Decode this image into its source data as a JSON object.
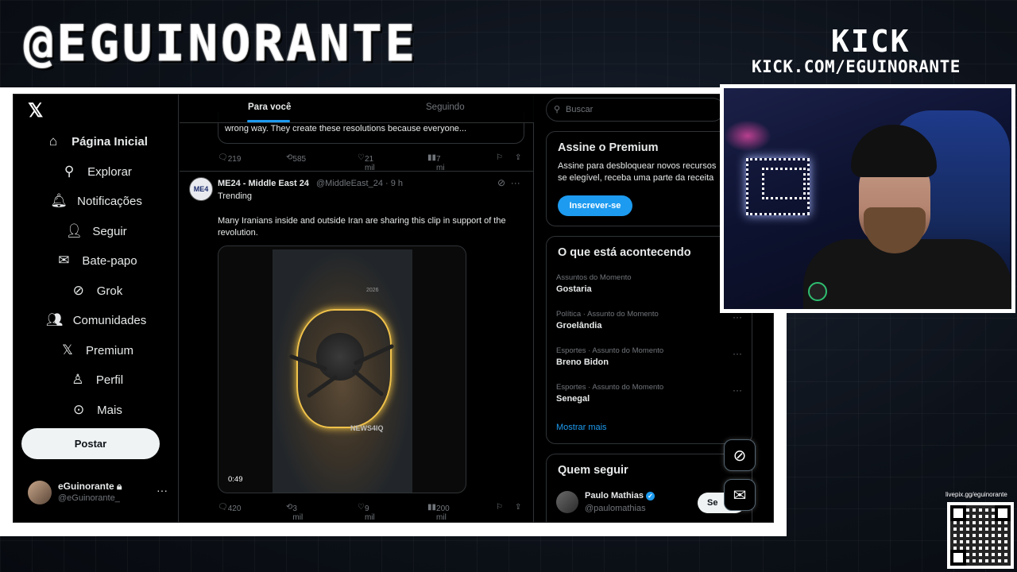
{
  "overlay": {
    "handle": "@EGUINORANTE",
    "platform": "KICK",
    "channel_url": "KICK.COM/EGUINORANTE",
    "qr_label": "livepix.gg/eguinorante"
  },
  "sidebar": {
    "items": [
      {
        "label": "Página Inicial",
        "icon": "home-icon"
      },
      {
        "label": "Explorar",
        "icon": "search-icon"
      },
      {
        "label": "Notificações",
        "icon": "bell-icon"
      },
      {
        "label": "Seguir",
        "icon": "follow-icon"
      },
      {
        "label": "Bate-papo",
        "icon": "mail-icon"
      },
      {
        "label": "Grok",
        "icon": "grok-icon"
      },
      {
        "label": "Comunidades",
        "icon": "communities-icon"
      },
      {
        "label": "Premium",
        "icon": "x-icon"
      },
      {
        "label": "Perfil",
        "icon": "profile-icon"
      },
      {
        "label": "Mais",
        "icon": "more-icon"
      }
    ],
    "post_button": "Postar",
    "profile": {
      "name": "eGuinorante",
      "handle": "@eGuinorante_"
    }
  },
  "timeline": {
    "tabs": {
      "for_you": "Para você",
      "following": "Seguindo"
    },
    "prev_post": {
      "quote_text": "wrong way. They create these resolutions because everyone...",
      "replies": "219",
      "reposts": "585",
      "likes": "21 mil",
      "views": "7 mi"
    },
    "post": {
      "avatar_text": "ME4",
      "author": "ME24 - Middle East 24",
      "meta": "@MiddleEast_24 · 9 h",
      "label": "Trending",
      "text": "Many Iranians inside and outside Iran are sharing this clip in support of the revolution.",
      "media_watermark": "NEWS4IQ",
      "media_year": "2026",
      "duration": "0:49",
      "replies": "420",
      "reposts": "3 mil",
      "likes": "9 mil",
      "views": "200 mil"
    }
  },
  "right": {
    "search_placeholder": "Buscar",
    "premium": {
      "title": "Assine o Premium",
      "desc_line1": "Assine para desbloquear novos recursos",
      "desc_line2": "se elegível, receba uma parte da receita",
      "button": "Inscrever-se"
    },
    "trends": {
      "title": "O que está acontecendo",
      "items": [
        {
          "meta": "Assuntos do Momento",
          "name": "Gostaria"
        },
        {
          "meta": "Política · Assunto do Momento",
          "name": "Groelândia"
        },
        {
          "meta": "Esportes · Assunto do Momento",
          "name": "Breno Bidon"
        },
        {
          "meta": "Esportes · Assunto do Momento",
          "name": "Senegal"
        }
      ],
      "show_more": "Mostrar mais"
    },
    "who_to_follow": {
      "title": "Quem seguir",
      "name": "Paulo Mathias",
      "handle": "@paulomathias",
      "button": "Se"
    }
  },
  "colors": {
    "accent": "#1d9bf0",
    "background": "#000000",
    "border": "#2f3336"
  }
}
